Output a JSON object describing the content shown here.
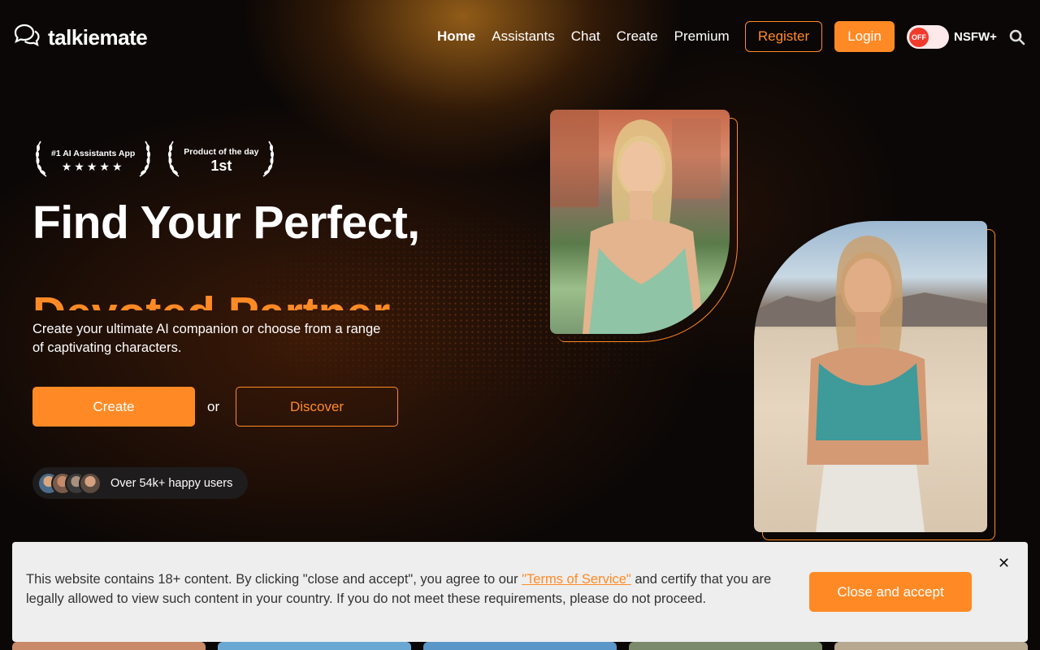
{
  "header": {
    "logo_text": "talkiemate",
    "nav": [
      "Home",
      "Assistants",
      "Chat",
      "Create",
      "Premium"
    ],
    "register_label": "Register",
    "login_label": "Login",
    "toggle_state": "OFF",
    "nsfw_label": "NSFW+"
  },
  "hero": {
    "award1_line": "#1 AI Assistants App",
    "award1_stars": "★★★★★",
    "award2_line": "Product of the day",
    "award2_rank": "1st",
    "title": "Find Your Perfect,",
    "subtitle": "Devoted Partner",
    "description": "Create your ultimate AI companion or choose from a range of captivating characters.",
    "create_label": "Create",
    "or_label": "or",
    "discover_label": "Discover",
    "users_text": "Over 54k+ happy users"
  },
  "banner": {
    "text_before": "This website contains 18+ content. By clicking \"close and accept\", you agree to our ",
    "link_text": "\"Terms of Service\"",
    "text_after": " and certify that you are legally allowed to view such content in your country. If you do not meet these requirements, please do not proceed.",
    "button_label": "Close and accept",
    "close_symbol": "✕"
  },
  "colors": {
    "accent": "#ff8a25",
    "background": "#0b0706",
    "banner_bg": "#eeeeee",
    "toggle_red": "#ef3b2c"
  }
}
